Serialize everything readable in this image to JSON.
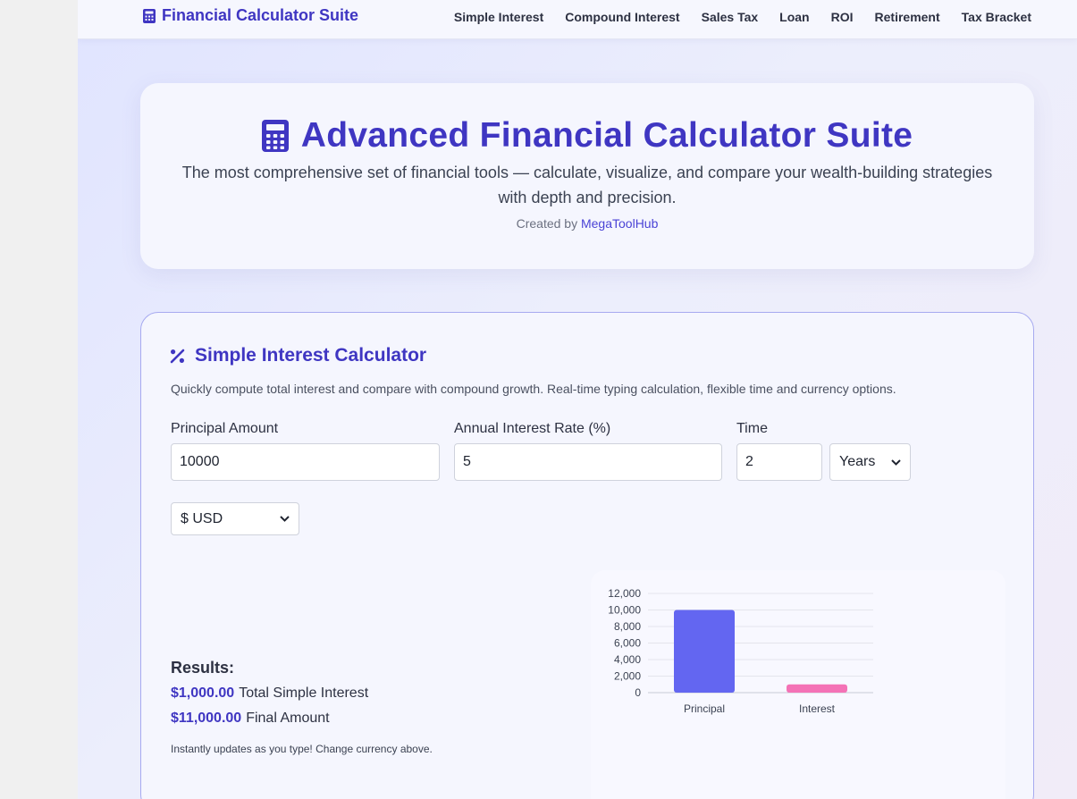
{
  "nav": {
    "brand": "Financial Calculator Suite",
    "brand_icon": "calculator-icon",
    "links": [
      "Simple Interest",
      "Compound Interest",
      "Sales Tax",
      "Loan",
      "ROI",
      "Retirement",
      "Tax Bracket"
    ]
  },
  "hero": {
    "title": "Advanced Financial Calculator Suite",
    "icon": "calculator-icon",
    "description": "The most comprehensive set of financial tools — calculate, visualize, and compare your wealth-building strategies with depth and precision.",
    "credit_prefix": "Created by",
    "credit_link": "MegaToolHub"
  },
  "calculator": {
    "title": "Simple Interest Calculator",
    "icon": "percent-icon",
    "description": "Quickly compute total interest and compare with compound growth. Real-time typing calculation, flexible time and currency options.",
    "principal_label": "Principal Amount",
    "principal_value": "10000",
    "rate_label": "Annual Interest Rate (%)",
    "rate_value": "5",
    "time_label": "Time",
    "time_value": "2",
    "time_unit": "Years",
    "currency": "$ USD",
    "results_heading": "Results:",
    "interest_amount": "$1,000.00",
    "interest_label": "Total Simple Interest",
    "final_amount": "$11,000.00",
    "final_label": "Final Amount",
    "note": "Instantly updates as you type! Change currency above."
  },
  "colors": {
    "accent": "#3f36c2",
    "principal_bar": "#6366f1",
    "interest_bar": "#f472b6"
  },
  "chart_data": {
    "type": "bar",
    "categories": [
      "Principal",
      "Interest"
    ],
    "values": [
      10000,
      1000
    ],
    "ylim": [
      0,
      12000
    ],
    "yticks": [
      0,
      2000,
      4000,
      6000,
      8000,
      10000,
      12000
    ],
    "grid": true
  }
}
